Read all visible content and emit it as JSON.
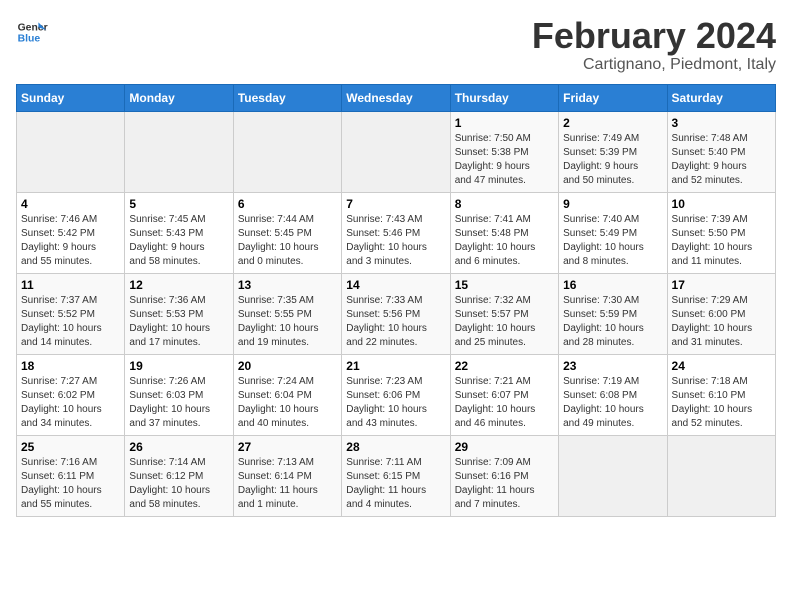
{
  "logo": {
    "text_general": "General",
    "text_blue": "Blue"
  },
  "header": {
    "month": "February 2024",
    "location": "Cartignano, Piedmont, Italy"
  },
  "weekdays": [
    "Sunday",
    "Monday",
    "Tuesday",
    "Wednesday",
    "Thursday",
    "Friday",
    "Saturday"
  ],
  "weeks": [
    [
      {
        "day": "",
        "info": ""
      },
      {
        "day": "",
        "info": ""
      },
      {
        "day": "",
        "info": ""
      },
      {
        "day": "",
        "info": ""
      },
      {
        "day": "1",
        "info": "Sunrise: 7:50 AM\nSunset: 5:38 PM\nDaylight: 9 hours\nand 47 minutes."
      },
      {
        "day": "2",
        "info": "Sunrise: 7:49 AM\nSunset: 5:39 PM\nDaylight: 9 hours\nand 50 minutes."
      },
      {
        "day": "3",
        "info": "Sunrise: 7:48 AM\nSunset: 5:40 PM\nDaylight: 9 hours\nand 52 minutes."
      }
    ],
    [
      {
        "day": "4",
        "info": "Sunrise: 7:46 AM\nSunset: 5:42 PM\nDaylight: 9 hours\nand 55 minutes."
      },
      {
        "day": "5",
        "info": "Sunrise: 7:45 AM\nSunset: 5:43 PM\nDaylight: 9 hours\nand 58 minutes."
      },
      {
        "day": "6",
        "info": "Sunrise: 7:44 AM\nSunset: 5:45 PM\nDaylight: 10 hours\nand 0 minutes."
      },
      {
        "day": "7",
        "info": "Sunrise: 7:43 AM\nSunset: 5:46 PM\nDaylight: 10 hours\nand 3 minutes."
      },
      {
        "day": "8",
        "info": "Sunrise: 7:41 AM\nSunset: 5:48 PM\nDaylight: 10 hours\nand 6 minutes."
      },
      {
        "day": "9",
        "info": "Sunrise: 7:40 AM\nSunset: 5:49 PM\nDaylight: 10 hours\nand 8 minutes."
      },
      {
        "day": "10",
        "info": "Sunrise: 7:39 AM\nSunset: 5:50 PM\nDaylight: 10 hours\nand 11 minutes."
      }
    ],
    [
      {
        "day": "11",
        "info": "Sunrise: 7:37 AM\nSunset: 5:52 PM\nDaylight: 10 hours\nand 14 minutes."
      },
      {
        "day": "12",
        "info": "Sunrise: 7:36 AM\nSunset: 5:53 PM\nDaylight: 10 hours\nand 17 minutes."
      },
      {
        "day": "13",
        "info": "Sunrise: 7:35 AM\nSunset: 5:55 PM\nDaylight: 10 hours\nand 19 minutes."
      },
      {
        "day": "14",
        "info": "Sunrise: 7:33 AM\nSunset: 5:56 PM\nDaylight: 10 hours\nand 22 minutes."
      },
      {
        "day": "15",
        "info": "Sunrise: 7:32 AM\nSunset: 5:57 PM\nDaylight: 10 hours\nand 25 minutes."
      },
      {
        "day": "16",
        "info": "Sunrise: 7:30 AM\nSunset: 5:59 PM\nDaylight: 10 hours\nand 28 minutes."
      },
      {
        "day": "17",
        "info": "Sunrise: 7:29 AM\nSunset: 6:00 PM\nDaylight: 10 hours\nand 31 minutes."
      }
    ],
    [
      {
        "day": "18",
        "info": "Sunrise: 7:27 AM\nSunset: 6:02 PM\nDaylight: 10 hours\nand 34 minutes."
      },
      {
        "day": "19",
        "info": "Sunrise: 7:26 AM\nSunset: 6:03 PM\nDaylight: 10 hours\nand 37 minutes."
      },
      {
        "day": "20",
        "info": "Sunrise: 7:24 AM\nSunset: 6:04 PM\nDaylight: 10 hours\nand 40 minutes."
      },
      {
        "day": "21",
        "info": "Sunrise: 7:23 AM\nSunset: 6:06 PM\nDaylight: 10 hours\nand 43 minutes."
      },
      {
        "day": "22",
        "info": "Sunrise: 7:21 AM\nSunset: 6:07 PM\nDaylight: 10 hours\nand 46 minutes."
      },
      {
        "day": "23",
        "info": "Sunrise: 7:19 AM\nSunset: 6:08 PM\nDaylight: 10 hours\nand 49 minutes."
      },
      {
        "day": "24",
        "info": "Sunrise: 7:18 AM\nSunset: 6:10 PM\nDaylight: 10 hours\nand 52 minutes."
      }
    ],
    [
      {
        "day": "25",
        "info": "Sunrise: 7:16 AM\nSunset: 6:11 PM\nDaylight: 10 hours\nand 55 minutes."
      },
      {
        "day": "26",
        "info": "Sunrise: 7:14 AM\nSunset: 6:12 PM\nDaylight: 10 hours\nand 58 minutes."
      },
      {
        "day": "27",
        "info": "Sunrise: 7:13 AM\nSunset: 6:14 PM\nDaylight: 11 hours\nand 1 minute."
      },
      {
        "day": "28",
        "info": "Sunrise: 7:11 AM\nSunset: 6:15 PM\nDaylight: 11 hours\nand 4 minutes."
      },
      {
        "day": "29",
        "info": "Sunrise: 7:09 AM\nSunset: 6:16 PM\nDaylight: 11 hours\nand 7 minutes."
      },
      {
        "day": "",
        "info": ""
      },
      {
        "day": "",
        "info": ""
      }
    ]
  ]
}
